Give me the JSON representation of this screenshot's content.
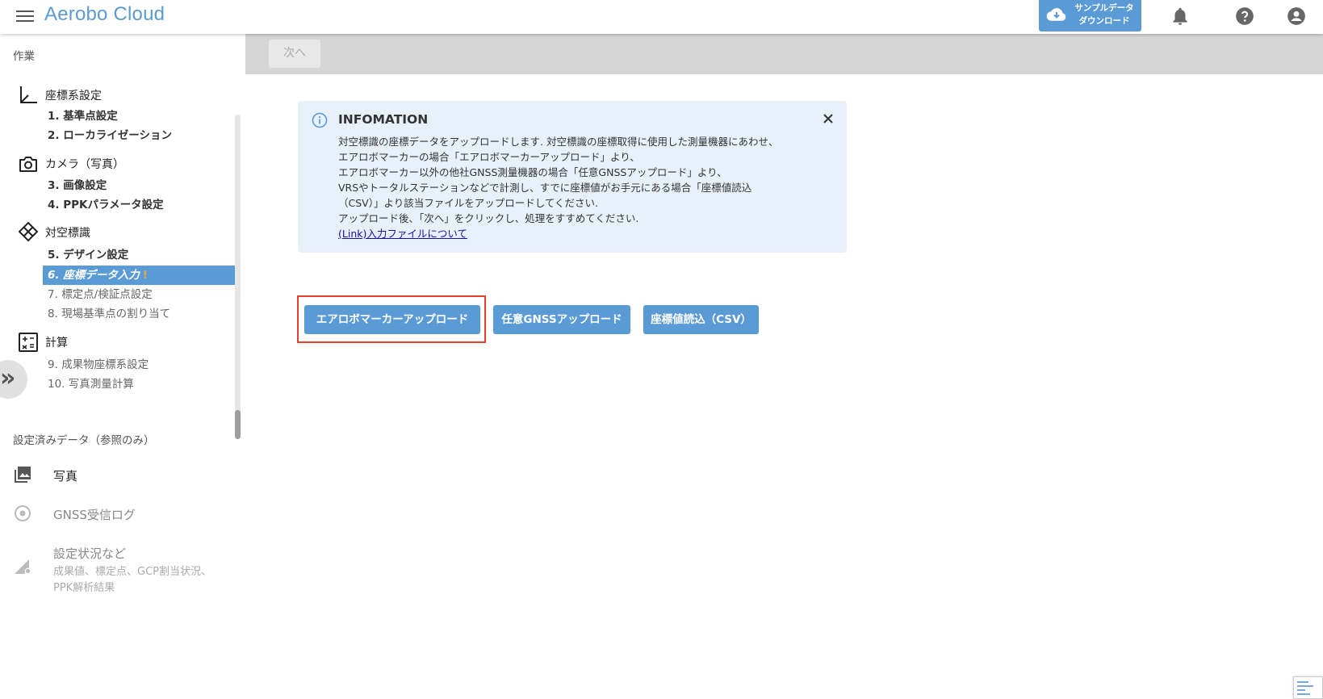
{
  "header": {
    "app_title": "Aerobo Cloud",
    "sample_download_label": "サンプルデータ\nダウンロード",
    "icons": [
      "menu-icon",
      "cloud-download-icon",
      "bell-icon",
      "help-icon",
      "account-icon"
    ]
  },
  "sidebar": {
    "tasks_caption": "作業",
    "groups": [
      {
        "title": "座標系設定",
        "icon": "axis-icon"
      },
      {
        "title": "カメラ（写真）",
        "icon": "camera-icon"
      },
      {
        "title": "対空標識",
        "icon": "target-marker-icon"
      },
      {
        "title": "計算",
        "icon": "calculator-icon"
      }
    ],
    "steps": [
      {
        "num": "1.",
        "label": "基準点設定",
        "state": "done"
      },
      {
        "num": "2.",
        "label": "ローカライゼーション",
        "state": "done"
      },
      {
        "num": "3.",
        "label": "画像設定",
        "state": "done"
      },
      {
        "num": "4.",
        "label": "PPKパラメータ設定",
        "state": "done"
      },
      {
        "num": "5.",
        "label": "デザイン設定",
        "state": "done"
      },
      {
        "num": "6.",
        "label": "座標データ入力",
        "state": "active",
        "warning": "!"
      },
      {
        "num": "7.",
        "label": "標定点/検証点設定",
        "state": "pending"
      },
      {
        "num": "8.",
        "label": "現場基準点の割り当て",
        "state": "pending"
      },
      {
        "num": "9.",
        "label": "成果物座標系設定",
        "state": "pending"
      },
      {
        "num": "10.",
        "label": "写真測量計算",
        "state": "pending"
      }
    ],
    "reference_caption": "設定済みデータ（参照のみ）",
    "reference_items": [
      {
        "label": "写真",
        "icon": "photo-library-icon"
      },
      {
        "label": "GNSS受信ログ",
        "icon": "gnss-log-icon"
      },
      {
        "label": "設定状況など",
        "sub": "成果値、標定点、GCP割当状況、\nPPK解析結果",
        "icon": "settings-status-icon"
      }
    ],
    "collapse_glyph": "»"
  },
  "main": {
    "next_button": "次へ",
    "info": {
      "title": "INFOMATION",
      "lines": [
        "対空標識の座標データをアップロードします. 対空標識の座標取得に使用した測量機器にあわせ、",
        "エアロボマーカーの場合「エアロボマーカーアップロード」より、",
        "エアロボマーカー以外の他社GNSS測量機器の場合「任意GNSSアップロード」より、",
        "VRSやトータルステーションなどで計測し、すでに座標値がお手元にある場合「座標値読込",
        "（CSV）」より該当ファイルをアップロードしてください.",
        "アップロード後、「次へ」をクリックし、処理をすすめてください."
      ],
      "link": "(Link)入力ファイルについて"
    },
    "buttons": {
      "aerobo_marker": "エアロボマーカーアップロード",
      "gnss": "任意GNSSアップロード",
      "csv": "座標値読込（CSV）"
    }
  }
}
